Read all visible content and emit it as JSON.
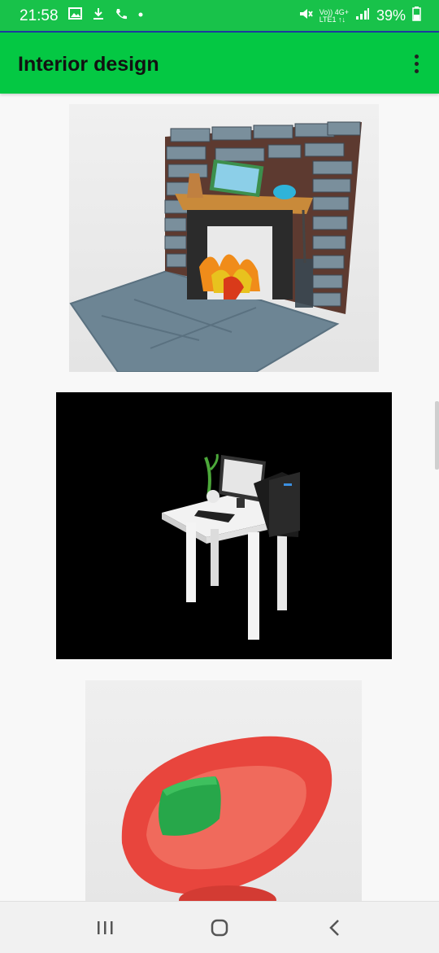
{
  "status_bar": {
    "time": "21:58",
    "network_top": "Vo)) 4G+",
    "network_bottom": "LTE1 ↑↓",
    "battery": "39%"
  },
  "app_bar": {
    "title": "Interior design"
  },
  "gallery": {
    "items": [
      {
        "subject": "fireplace"
      },
      {
        "subject": "computer-desk"
      },
      {
        "subject": "egg-chair"
      }
    ]
  },
  "icons": {
    "status_left": [
      "gallery-icon",
      "download-icon",
      "phone-icon",
      "dot-icon"
    ],
    "status_right": [
      "mute-icon",
      "signal-icon",
      "battery-icon"
    ],
    "nav": [
      "recent-apps-icon",
      "home-icon",
      "back-icon"
    ]
  },
  "colors": {
    "status_bar": "#18c24a",
    "app_bar": "#04c843",
    "chair_red": "#e8453d",
    "cushion_green": "#27a74a"
  }
}
